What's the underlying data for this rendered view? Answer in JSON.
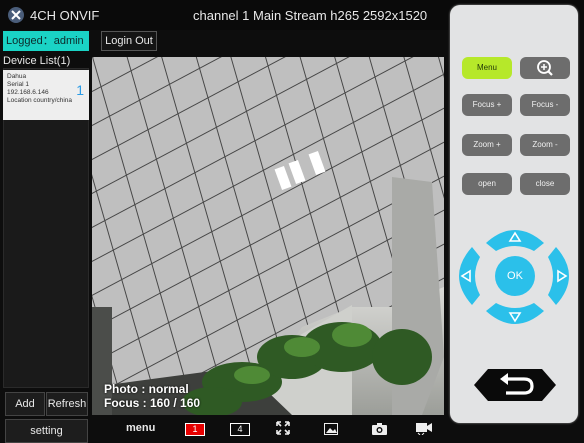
{
  "header": {
    "app_name": "4CH ONVIF",
    "stream_info": "channel 1 Main Stream h265 2592x1520"
  },
  "session": {
    "logged_label": "Logged：admin",
    "login_out_label": "Login Out"
  },
  "device_list": {
    "title": "Device List(1)",
    "devices": [
      {
        "name": "Dahua",
        "serial": "Serial 1",
        "ip": "192.168.6.146",
        "location": "Location country/china",
        "index": "1"
      }
    ]
  },
  "left_buttons": {
    "add": "Add",
    "refresh": "Refresh",
    "setting": "setting"
  },
  "video": {
    "photo_mode": "Photo : normal",
    "focus": "Focus : 160 / 160"
  },
  "toolbar": {
    "menu_label": "menu",
    "channel_single": "1",
    "channel_quad": "4",
    "active_color": "#e60000"
  },
  "control_panel": {
    "menu": "Menu",
    "focus_plus": "Focus +",
    "focus_minus": "Focus -",
    "zoom_plus": "Zoom +",
    "zoom_minus": "Zoom -",
    "open": "open",
    "close": "close",
    "ok": "OK",
    "accent_green": "#b6e82a",
    "accent_blue": "#2bc0ea"
  }
}
